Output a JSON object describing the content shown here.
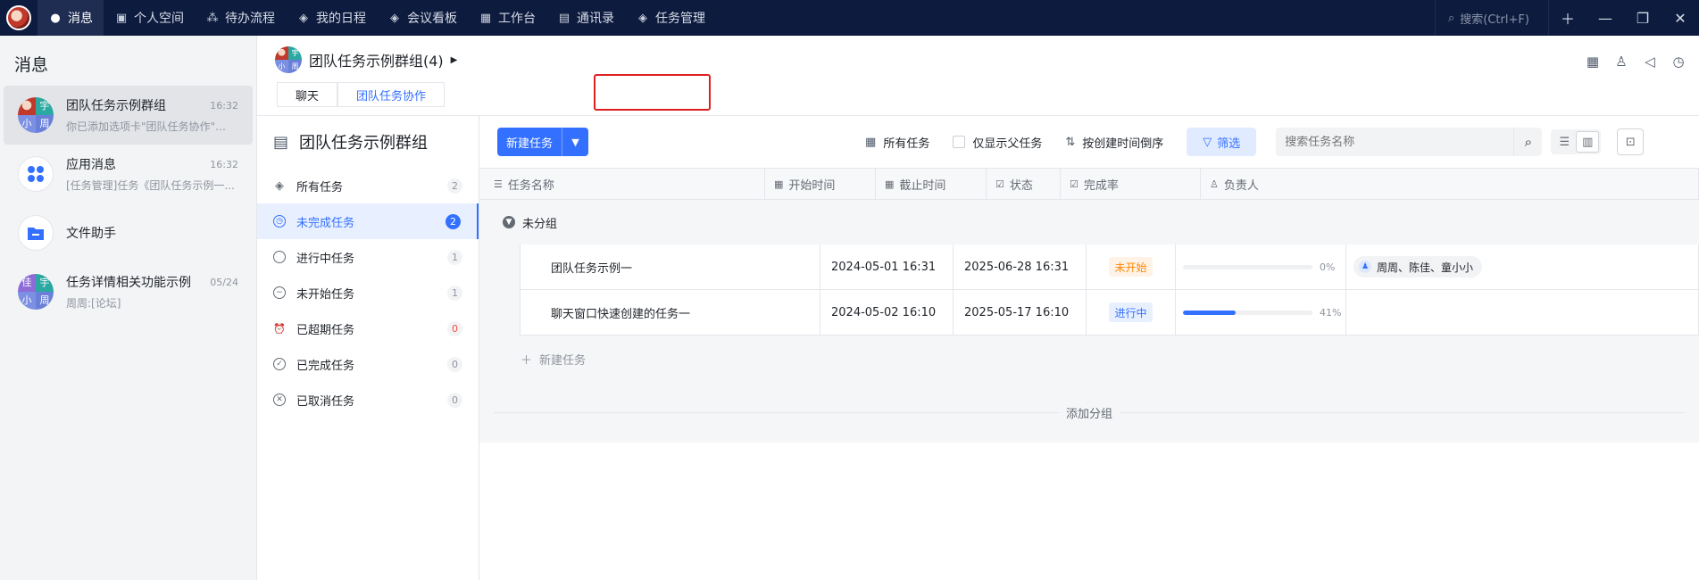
{
  "topnav": {
    "items": [
      {
        "label": "消息",
        "icon": "chat-bubble-icon",
        "glyph": "●",
        "active": true
      },
      {
        "label": "个人空间",
        "icon": "personal-space-icon",
        "glyph": "▣",
        "active": false
      },
      {
        "label": "待办流程",
        "icon": "workflow-icon",
        "glyph": "⁂",
        "active": false
      },
      {
        "label": "我的日程",
        "icon": "layers-icon",
        "glyph": "◈",
        "active": false
      },
      {
        "label": "会议看板",
        "icon": "layers-icon",
        "glyph": "◈",
        "active": false
      },
      {
        "label": "工作台",
        "icon": "grid-icon",
        "glyph": "▦",
        "active": false
      },
      {
        "label": "通讯录",
        "icon": "contacts-icon",
        "glyph": "▤",
        "active": false
      },
      {
        "label": "任务管理",
        "icon": "layers-icon",
        "glyph": "◈",
        "active": false
      }
    ],
    "search_placeholder": "搜索(Ctrl+F)"
  },
  "sidebar": {
    "title": "消息",
    "conversations": [
      {
        "name": "团队任务示例群组",
        "preview": "你已添加选项卡\"团队任务协作\"至...",
        "time": "16:32",
        "avatar": [
          "",
          "宇",
          "小",
          "周"
        ],
        "selected": true
      },
      {
        "name": "应用消息",
        "preview": "[任务管理]任务《团队任务示例一...",
        "time": "16:32",
        "avatar": "app-grid-icon",
        "selected": false
      },
      {
        "name": "文件助手",
        "preview": "",
        "time": "",
        "avatar": "folder-icon",
        "selected": false
      },
      {
        "name": "任务详情相关功能示例",
        "preview": "周周:[论坛]",
        "time": "05/24",
        "avatar": [
          "佳",
          "宇",
          "小",
          "周"
        ],
        "selected": false
      }
    ]
  },
  "chat": {
    "group_name": "团队任务示例群组(4)",
    "avatar": [
      "",
      "宇",
      "小",
      "周"
    ],
    "tabs": [
      {
        "label": "聊天",
        "active": false
      },
      {
        "label": "团队任务协作",
        "active": true
      }
    ]
  },
  "task_sidebar": {
    "title": "团队任务示例群组",
    "filters": [
      {
        "label": "所有任务",
        "count": "2",
        "icon": "layers-icon",
        "selected": false
      },
      {
        "label": "未完成任务",
        "count": "2",
        "icon": "clock-icon",
        "selected": true
      },
      {
        "label": "进行中任务",
        "count": "1",
        "icon": "circle-icon",
        "selected": false
      },
      {
        "label": "未开始任务",
        "count": "1",
        "icon": "minus-circle-icon",
        "selected": false
      },
      {
        "label": "已超期任务",
        "count": "0",
        "icon": "alarm-icon",
        "selected": false,
        "alert": true
      },
      {
        "label": "已完成任务",
        "count": "0",
        "icon": "check-circle-icon",
        "selected": false
      },
      {
        "label": "已取消任务",
        "count": "0",
        "icon": "x-circle-icon",
        "selected": false
      }
    ]
  },
  "toolbar": {
    "new_task": "新建任务",
    "all_tasks": "所有任务",
    "only_parent": "仅显示父任务",
    "sort": "按创建时间倒序",
    "filter": "筛选",
    "search_placeholder": "搜索任务名称"
  },
  "table": {
    "headers": [
      "任务名称",
      "开始时间",
      "截止时间",
      "状态",
      "完成率",
      "负责人"
    ],
    "group_label": "未分组",
    "rows": [
      {
        "name": "团队任务示例一",
        "start": "2024-05-01 16:31",
        "end": "2025-06-28 16:31",
        "status": "未开始",
        "status_kind": "todo",
        "progress": 0,
        "progress_label": "0%",
        "owners": "周周、陈佳、童小小"
      },
      {
        "name": "聊天窗口快速创建的任务一",
        "start": "2024-05-02 16:10",
        "end": "2025-05-17 16:10",
        "status": "进行中",
        "status_kind": "doing",
        "progress": 41,
        "progress_label": "41%",
        "owners": ""
      }
    ],
    "new_task_label": "新建任务",
    "add_group_label": "添加分组"
  }
}
